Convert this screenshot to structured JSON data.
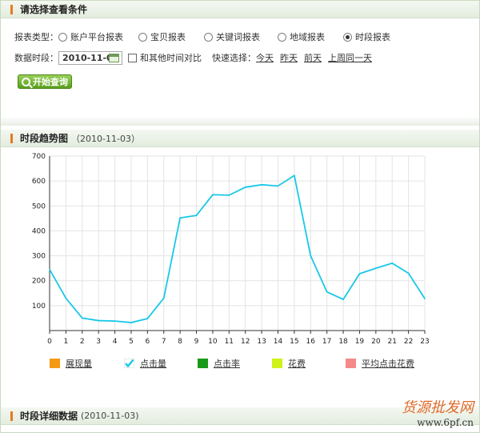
{
  "filter_section": {
    "title": "请选择查看条件"
  },
  "report_type": {
    "label": "报表类型：",
    "options": [
      {
        "label": "账户平台报表",
        "selected": false
      },
      {
        "label": "宝贝报表",
        "selected": false
      },
      {
        "label": "关键词报表",
        "selected": false
      },
      {
        "label": "地域报表",
        "selected": false
      },
      {
        "label": "时段报表",
        "selected": true
      }
    ]
  },
  "date_period": {
    "label": "数据时段：",
    "value": "2010-11-03",
    "compare_label": "和其他时间对比",
    "quick_label": "快速选择：",
    "quick_links": [
      "今天",
      "昨天",
      "前天",
      "上周同一天"
    ]
  },
  "query_button": {
    "label": "开始查询"
  },
  "trend_section": {
    "title": "时段趋势图",
    "date": "（2010-11-03）"
  },
  "detail_section": {
    "title": "时段详细数据",
    "date": "(2010-11-03)"
  },
  "legend": [
    {
      "label": "展现量",
      "color": "#f39a12",
      "checked": false
    },
    {
      "label": "点击量",
      "color": "#18c8e8",
      "checked": true
    },
    {
      "label": "点击率",
      "color": "#1a9a1a",
      "checked": false
    },
    {
      "label": "花费",
      "color": "#cff21a",
      "checked": false
    },
    {
      "label": "平均点击花费",
      "color": "#f48a8a",
      "checked": false
    }
  ],
  "watermark": {
    "text": "货源批发网",
    "small": "www.6pf.cn"
  },
  "chart_data": {
    "type": "line",
    "x": [
      0,
      1,
      2,
      3,
      4,
      5,
      6,
      7,
      8,
      9,
      10,
      11,
      12,
      13,
      14,
      15,
      16,
      17,
      18,
      19,
      20,
      21,
      22,
      23
    ],
    "series": [
      {
        "name": "点击量",
        "color": "#18c8e8",
        "values": [
          245,
          130,
          50,
          40,
          38,
          32,
          48,
          130,
          452,
          462,
          545,
          543,
          575,
          585,
          580,
          622,
          300,
          155,
          125,
          228,
          250,
          270,
          230,
          128
        ]
      }
    ],
    "ylim": [
      0,
      700
    ],
    "yticks": [
      100,
      200,
      300,
      400,
      500,
      600,
      700
    ],
    "grid": true
  }
}
